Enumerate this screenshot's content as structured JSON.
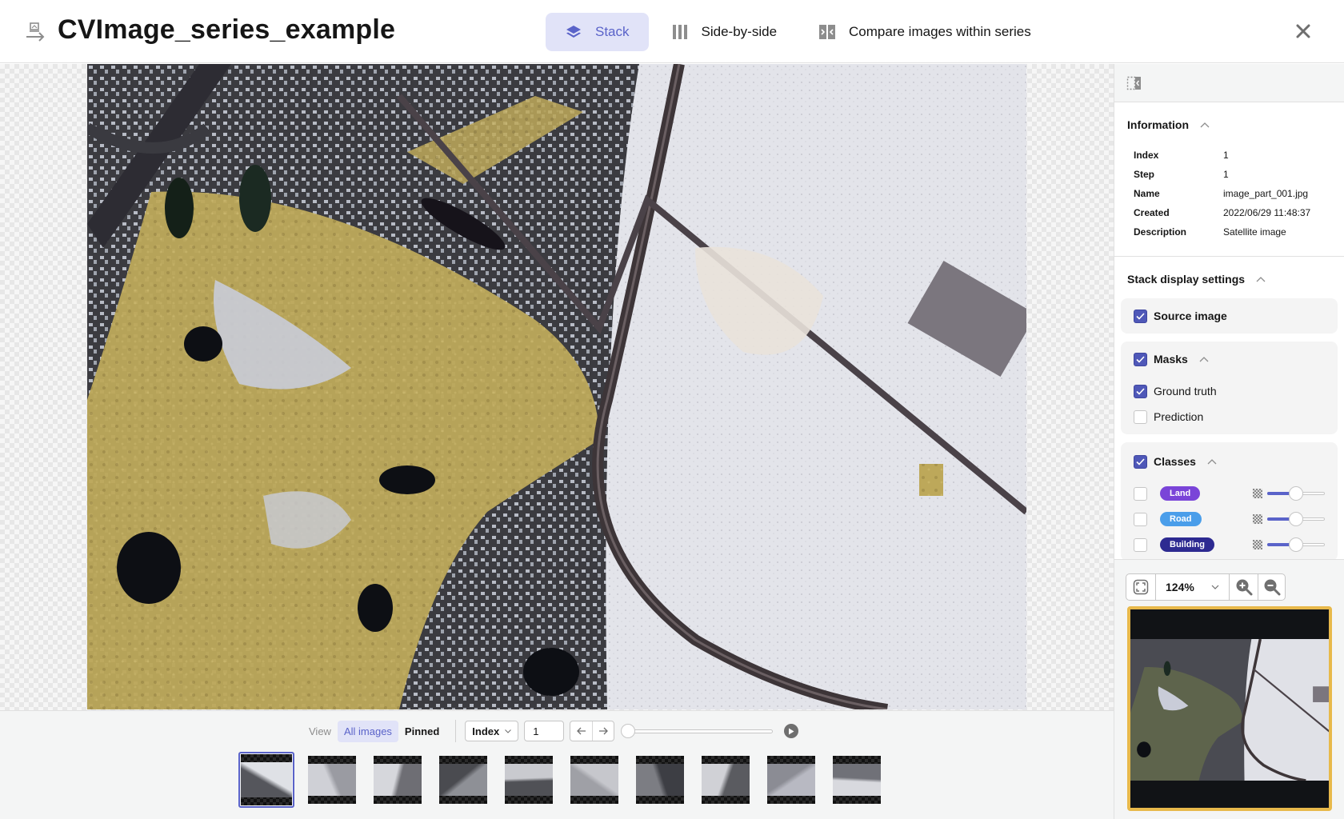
{
  "header": {
    "title": "CVImage_series_example",
    "back_icon": "image-export-arrow-icon",
    "close_icon": "close-icon",
    "modes": [
      {
        "label": "Stack",
        "icon": "layers-icon",
        "active": true
      },
      {
        "label": "Side-by-side",
        "icon": "columns-icon",
        "active": false
      },
      {
        "label": "Compare images within series",
        "icon": "compare-icon",
        "active": false
      }
    ]
  },
  "viewer": {
    "view_label": "View",
    "view_options": [
      "All images",
      "Pinned"
    ],
    "active_view": "All images",
    "sort_select": "Index",
    "index_value": "1",
    "prev_icon": "arrow-left-icon",
    "next_icon": "arrow-right-icon",
    "slider_position": 0,
    "play_icon": "play-icon",
    "thumbnails": [
      {
        "index": 1,
        "selected": true
      },
      {
        "index": 2,
        "selected": false
      },
      {
        "index": 3,
        "selected": false
      },
      {
        "index": 4,
        "selected": false
      },
      {
        "index": 5,
        "selected": false
      },
      {
        "index": 6,
        "selected": false
      },
      {
        "index": 7,
        "selected": false
      },
      {
        "index": 8,
        "selected": false
      },
      {
        "index": 9,
        "selected": false
      },
      {
        "index": 10,
        "selected": false
      }
    ]
  },
  "panel": {
    "collapse_icon": "panel-collapse-icon",
    "information": {
      "title": "Information",
      "rows": [
        {
          "key": "Index",
          "value": "1"
        },
        {
          "key": "Step",
          "value": "1"
        },
        {
          "key": "Name",
          "value": "image_part_001.jpg"
        },
        {
          "key": "Created",
          "value": "2022/06/29 11:48:37"
        },
        {
          "key": "Description",
          "value": "Satellite image"
        }
      ]
    },
    "stack_settings": {
      "title": "Stack display settings",
      "source_image": {
        "label": "Source image",
        "checked": true
      },
      "masks": {
        "label": "Masks",
        "checked": true,
        "items": [
          {
            "label": "Ground truth",
            "checked": true
          },
          {
            "label": "Prediction",
            "checked": false
          }
        ]
      },
      "classes": {
        "label": "Classes",
        "checked": true,
        "items": [
          {
            "label": "Land",
            "color": "#7a44d8",
            "checked": false,
            "opacity": 0.5
          },
          {
            "label": "Road",
            "color": "#4a9eea",
            "checked": false,
            "opacity": 0.5
          },
          {
            "label": "Building",
            "color": "#2d2a91",
            "checked": false,
            "opacity": 0.5
          }
        ]
      }
    },
    "zoom": {
      "fit_icon": "fit-screen-icon",
      "value": "124%",
      "zoom_in_icon": "zoom-in-icon",
      "zoom_out_icon": "zoom-out-icon"
    }
  },
  "colors": {
    "accent": "#5a63c9",
    "accent_bg": "#e1e3f8",
    "checkbox": "#4f58b8",
    "navigator_border": "#e8b94b",
    "mask_overlay": "#bfae5a"
  }
}
